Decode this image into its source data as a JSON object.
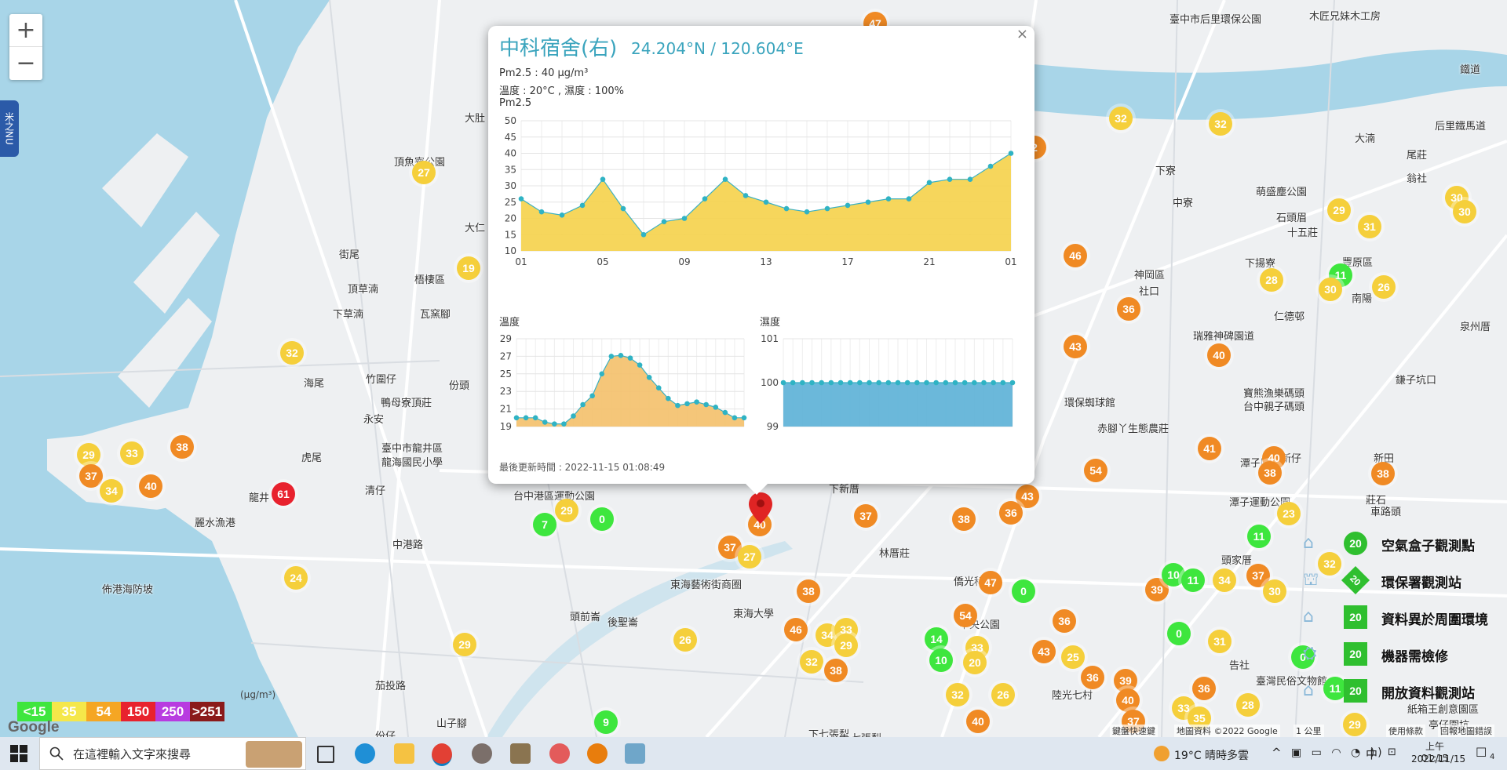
{
  "map": {
    "zoom_in": "+",
    "zoom_out": "−",
    "side_tab": "米之NU",
    "places": [
      {
        "name": "臺中市后里環保公園",
        "x": 1490,
        "y": 14
      },
      {
        "name": "木匠兄妹木工房",
        "x": 1668,
        "y": 10
      },
      {
        "name": "頂魚寮公園",
        "x": 502,
        "y": 196
      },
      {
        "name": "大肚",
        "x": 592,
        "y": 140
      },
      {
        "name": "大仁",
        "x": 592,
        "y": 280
      },
      {
        "name": "街尾",
        "x": 432,
        "y": 314
      },
      {
        "name": "梧棲區",
        "x": 528,
        "y": 346
      },
      {
        "name": "頂草湳",
        "x": 443,
        "y": 358
      },
      {
        "name": "下草湳",
        "x": 424,
        "y": 390
      },
      {
        "name": "瓦窯腳",
        "x": 535,
        "y": 390
      },
      {
        "name": "海尾",
        "x": 387,
        "y": 478
      },
      {
        "name": "竹圍仔",
        "x": 466,
        "y": 473
      },
      {
        "name": "鴨母寮頂莊",
        "x": 485,
        "y": 503
      },
      {
        "name": "永安",
        "x": 463,
        "y": 524
      },
      {
        "name": "虎尾",
        "x": 384,
        "y": 573
      },
      {
        "name": "臺中市龍井區",
        "x": 486,
        "y": 561
      },
      {
        "name": "龍海國民小學",
        "x": 486,
        "y": 579
      },
      {
        "name": "清仔",
        "x": 465,
        "y": 615
      },
      {
        "name": "龍井",
        "x": 317,
        "y": 624
      },
      {
        "name": "麗水漁港",
        "x": 248,
        "y": 656
      },
      {
        "name": "佈港海防坡",
        "x": 130,
        "y": 741
      },
      {
        "name": "台中港區運動公園",
        "x": 654,
        "y": 622
      },
      {
        "name": "東海藝術街商圈",
        "x": 854,
        "y": 735
      },
      {
        "name": "頭前崙",
        "x": 726,
        "y": 776
      },
      {
        "name": "後聖崙",
        "x": 774,
        "y": 783
      },
      {
        "name": "東海大學",
        "x": 934,
        "y": 772
      },
      {
        "name": "林厝莊",
        "x": 1120,
        "y": 695
      },
      {
        "name": "中央公園",
        "x": 1222,
        "y": 786
      },
      {
        "name": "下新厝",
        "x": 1056,
        "y": 613
      },
      {
        "name": "神岡區",
        "x": 1445,
        "y": 340
      },
      {
        "name": "社口",
        "x": 1451,
        "y": 361
      },
      {
        "name": "中寮",
        "x": 1494,
        "y": 248
      },
      {
        "name": "下寮",
        "x": 1472,
        "y": 207
      },
      {
        "name": "豐原區",
        "x": 1710,
        "y": 324
      },
      {
        "name": "南陽",
        "x": 1722,
        "y": 370
      },
      {
        "name": "仁德邨",
        "x": 1623,
        "y": 393
      },
      {
        "name": "泉州厝",
        "x": 1860,
        "y": 406
      },
      {
        "name": "瑞雅神碑園道",
        "x": 1520,
        "y": 418
      },
      {
        "name": "寶熊漁樂碼頭",
        "x": 1584,
        "y": 491
      },
      {
        "name": "台中親子碼頭",
        "x": 1584,
        "y": 508
      },
      {
        "name": "赤腳丫生態農莊",
        "x": 1398,
        "y": 536
      },
      {
        "name": "環保蜘球館",
        "x": 1356,
        "y": 503
      },
      {
        "name": "潭子運動公園",
        "x": 1566,
        "y": 630
      },
      {
        "name": "新仔",
        "x": 1632,
        "y": 574
      },
      {
        "name": "新田",
        "x": 1750,
        "y": 574
      },
      {
        "name": "潭子區",
        "x": 1580,
        "y": 580
      },
      {
        "name": "莊石",
        "x": 1740,
        "y": 627
      },
      {
        "name": "車路頭",
        "x": 1746,
        "y": 642
      },
      {
        "name": "頭家厝",
        "x": 1556,
        "y": 704
      },
      {
        "name": "僑光科技",
        "x": 1215,
        "y": 731
      },
      {
        "name": "石頭眉",
        "x": 1626,
        "y": 267
      },
      {
        "name": "十五莊",
        "x": 1640,
        "y": 286
      },
      {
        "name": "下揚寮",
        "x": 1586,
        "y": 325
      },
      {
        "name": "后里鐵馬道",
        "x": 1828,
        "y": 150
      },
      {
        "name": "大湳",
        "x": 1726,
        "y": 166
      },
      {
        "name": "尾莊",
        "x": 1792,
        "y": 187
      },
      {
        "name": "翁社",
        "x": 1792,
        "y": 217
      },
      {
        "name": "萌盛塵公園",
        "x": 1600,
        "y": 234
      },
      {
        "name": "鎌子坑口",
        "x": 1778,
        "y": 474
      },
      {
        "name": "七張犁",
        "x": 1084,
        "y": 931
      },
      {
        "name": "中港路",
        "x": 500,
        "y": 684
      },
      {
        "name": "茄投路",
        "x": 478,
        "y": 864
      },
      {
        "name": "份仔",
        "x": 478,
        "y": 928
      },
      {
        "name": "山子腳",
        "x": 556,
        "y": 912
      },
      {
        "name": "陸光七村",
        "x": 1340,
        "y": 876
      },
      {
        "name": "亭仔圍坑",
        "x": 1820,
        "y": 914
      },
      {
        "name": "紙箱王創意園區",
        "x": 1793,
        "y": 894
      },
      {
        "name": "告社",
        "x": 1566,
        "y": 838
      },
      {
        "name": "臺灣民俗文物館",
        "x": 1600,
        "y": 858
      },
      {
        "name": "下七張犁",
        "x": 1030,
        "y": 926
      },
      {
        "name": "份頭",
        "x": 572,
        "y": 481
      },
      {
        "name": "鐵道",
        "x": 1860,
        "y": 78
      }
    ],
    "markers": [
      {
        "v": "47",
        "c": "#f08a24",
        "x": 1115,
        "y": 30
      },
      {
        "v": "32",
        "c": "#f5cf3b",
        "x": 1428,
        "y": 151
      },
      {
        "v": "32",
        "c": "#f5cf3b",
        "x": 1555,
        "y": 158
      },
      {
        "v": "27",
        "c": "#f5cf3b",
        "x": 540,
        "y": 220
      },
      {
        "v": "2",
        "c": "#f08a24",
        "x": 1318,
        "y": 188
      },
      {
        "v": "46",
        "c": "#f08a24",
        "x": 1370,
        "y": 326
      },
      {
        "v": "36",
        "c": "#f08a24",
        "x": 1438,
        "y": 394
      },
      {
        "v": "43",
        "c": "#f08a24",
        "x": 1370,
        "y": 442
      },
      {
        "v": "40",
        "c": "#f08a24",
        "x": 1553,
        "y": 453
      },
      {
        "v": "19",
        "c": "#f5cf3b",
        "x": 597,
        "y": 342
      },
      {
        "v": "32",
        "c": "#f5cf3b",
        "x": 372,
        "y": 450
      },
      {
        "v": "29",
        "c": "#f5cf3b",
        "x": 1706,
        "y": 268
      },
      {
        "v": "31",
        "c": "#f5cf3b",
        "x": 1745,
        "y": 289
      },
      {
        "v": "30",
        "c": "#f5cf3b",
        "x": 1856,
        "y": 252
      },
      {
        "v": "30",
        "c": "#f5cf3b",
        "x": 1866,
        "y": 270
      },
      {
        "v": "28",
        "c": "#f5cf3b",
        "x": 1620,
        "y": 357
      },
      {
        "v": "11",
        "c": "#3ee63e",
        "x": 1708,
        "y": 351
      },
      {
        "v": "30",
        "c": "#f5cf3b",
        "x": 1695,
        "y": 369
      },
      {
        "v": "26",
        "c": "#f5cf3b",
        "x": 1763,
        "y": 366
      },
      {
        "v": "29",
        "c": "#f5cf3b",
        "x": 113,
        "y": 580
      },
      {
        "v": "33",
        "c": "#f5cf3b",
        "x": 168,
        "y": 578
      },
      {
        "v": "38",
        "c": "#f08a24",
        "x": 232,
        "y": 570
      },
      {
        "v": "37",
        "c": "#f08a24",
        "x": 116,
        "y": 607
      },
      {
        "v": "40",
        "c": "#f08a24",
        "x": 192,
        "y": 620
      },
      {
        "v": "34",
        "c": "#f5cf3b",
        "x": 142,
        "y": 626
      },
      {
        "v": "61",
        "c": "#e8222e",
        "x": 361,
        "y": 630
      },
      {
        "v": "29",
        "c": "#f5cf3b",
        "x": 722,
        "y": 651
      },
      {
        "v": "7",
        "c": "#3ee63e",
        "x": 694,
        "y": 669
      },
      {
        "v": "0",
        "c": "#3ee63e",
        "x": 767,
        "y": 662
      },
      {
        "v": "37",
        "c": "#f08a24",
        "x": 1103,
        "y": 658
      },
      {
        "v": "38",
        "c": "#f08a24",
        "x": 1228,
        "y": 662
      },
      {
        "v": "43",
        "c": "#f08a24",
        "x": 1309,
        "y": 633
      },
      {
        "v": "36",
        "c": "#f08a24",
        "x": 1288,
        "y": 654
      },
      {
        "v": "54",
        "c": "#f08a24",
        "x": 1396,
        "y": 600
      },
      {
        "v": "41",
        "c": "#f08a24",
        "x": 1541,
        "y": 572
      },
      {
        "v": "40",
        "c": "#f08a24",
        "x": 1623,
        "y": 584
      },
      {
        "v": "38",
        "c": "#f08a24",
        "x": 1618,
        "y": 603
      },
      {
        "v": "38",
        "c": "#f08a24",
        "x": 1762,
        "y": 604
      },
      {
        "v": "23",
        "c": "#f5cf3b",
        "x": 1642,
        "y": 655
      },
      {
        "v": "11",
        "c": "#3ee63e",
        "x": 1604,
        "y": 684
      },
      {
        "v": "40",
        "c": "#f08a24",
        "x": 968,
        "y": 669
      },
      {
        "v": "37",
        "c": "#f08a24",
        "x": 930,
        "y": 698
      },
      {
        "v": "27",
        "c": "#f5cf3b",
        "x": 955,
        "y": 710
      },
      {
        "v": "24",
        "c": "#f5cf3b",
        "x": 377,
        "y": 737
      },
      {
        "v": "38",
        "c": "#f08a24",
        "x": 1030,
        "y": 754
      },
      {
        "v": "47",
        "c": "#f08a24",
        "x": 1262,
        "y": 743
      },
      {
        "v": "0",
        "c": "#3ee63e",
        "x": 1304,
        "y": 754
      },
      {
        "v": "54",
        "c": "#f08a24",
        "x": 1230,
        "y": 785
      },
      {
        "v": "36",
        "c": "#f08a24",
        "x": 1356,
        "y": 792
      },
      {
        "v": "39",
        "c": "#f08a24",
        "x": 1474,
        "y": 752
      },
      {
        "v": "10",
        "c": "#3ee63e",
        "x": 1495,
        "y": 733
      },
      {
        "v": "11",
        "c": "#3ee63e",
        "x": 1520,
        "y": 740
      },
      {
        "v": "34",
        "c": "#f5cf3b",
        "x": 1560,
        "y": 740
      },
      {
        "v": "37",
        "c": "#f08a24",
        "x": 1603,
        "y": 734
      },
      {
        "v": "30",
        "c": "#f5cf3b",
        "x": 1624,
        "y": 754
      },
      {
        "v": "32",
        "c": "#f5cf3b",
        "x": 1694,
        "y": 719
      },
      {
        "v": "26",
        "c": "#f5cf3b",
        "x": 873,
        "y": 816
      },
      {
        "v": "46",
        "c": "#f08a24",
        "x": 1014,
        "y": 803
      },
      {
        "v": "34",
        "c": "#f5cf3b",
        "x": 1054,
        "y": 810
      },
      {
        "v": "33",
        "c": "#f5cf3b",
        "x": 1078,
        "y": 803
      },
      {
        "v": "29",
        "c": "#f5cf3b",
        "x": 1078,
        "y": 823
      },
      {
        "v": "32",
        "c": "#f5cf3b",
        "x": 1034,
        "y": 844
      },
      {
        "v": "38",
        "c": "#f08a24",
        "x": 1065,
        "y": 855
      },
      {
        "v": "14",
        "c": "#3ee63e",
        "x": 1193,
        "y": 815
      },
      {
        "v": "10",
        "c": "#3ee63e",
        "x": 1199,
        "y": 842
      },
      {
        "v": "33",
        "c": "#f5cf3b",
        "x": 1245,
        "y": 826
      },
      {
        "v": "20",
        "c": "#f5cf3b",
        "x": 1242,
        "y": 845
      },
      {
        "v": "43",
        "c": "#f08a24",
        "x": 1330,
        "y": 831
      },
      {
        "v": "25",
        "c": "#f5cf3b",
        "x": 1367,
        "y": 838
      },
      {
        "v": "0",
        "c": "#3ee63e",
        "x": 1502,
        "y": 808
      },
      {
        "v": "31",
        "c": "#f5cf3b",
        "x": 1554,
        "y": 818
      },
      {
        "v": "0",
        "c": "#3ee63e",
        "x": 1660,
        "y": 838
      },
      {
        "v": "29",
        "c": "#f5cf3b",
        "x": 592,
        "y": 822
      },
      {
        "v": "36",
        "c": "#f08a24",
        "x": 1392,
        "y": 864
      },
      {
        "v": "39",
        "c": "#f08a24",
        "x": 1434,
        "y": 868
      },
      {
        "v": "36",
        "c": "#f08a24",
        "x": 1534,
        "y": 878
      },
      {
        "v": "32",
        "c": "#f5cf3b",
        "x": 1220,
        "y": 886
      },
      {
        "v": "26",
        "c": "#f5cf3b",
        "x": 1278,
        "y": 886
      },
      {
        "v": "40",
        "c": "#f08a24",
        "x": 1437,
        "y": 893
      },
      {
        "v": "33",
        "c": "#f5cf3b",
        "x": 1508,
        "y": 903
      },
      {
        "v": "28",
        "c": "#f5cf3b",
        "x": 1590,
        "y": 899
      },
      {
        "v": "40",
        "c": "#f08a24",
        "x": 1246,
        "y": 920
      },
      {
        "v": "37",
        "c": "#f08a24",
        "x": 1444,
        "y": 920
      },
      {
        "v": "35",
        "c": "#f5cf3b",
        "x": 1528,
        "y": 916
      },
      {
        "v": "9",
        "c": "#3ee63e",
        "x": 772,
        "y": 921
      },
      {
        "v": "11",
        "c": "#3ee63e",
        "x": 1701,
        "y": 878
      },
      {
        "v": "29",
        "c": "#f5cf3b",
        "x": 1726,
        "y": 924
      }
    ]
  },
  "popup": {
    "title": "中科宿舍(右)",
    "coord": "24.204°N / 120.604°E",
    "pm25_line": "Pm2.5 : 40 μg/m³",
    "temp_line": "溫度 : 20°C , 濕度 : 100%",
    "pm_chart_label": "Pm2.5",
    "temp_chart_label": "溫度",
    "hum_chart_label": "濕度",
    "update": "最後更新時間 : 2022-11-15 01:08:49",
    "close": "×"
  },
  "chart_data": [
    {
      "type": "area",
      "title": "Pm2.5",
      "ylim": [
        10,
        50
      ],
      "yticks": [
        10,
        15,
        20,
        25,
        30,
        35,
        40,
        45,
        50
      ],
      "xticks": [
        "01",
        "05",
        "09",
        "13",
        "17",
        "21",
        "01"
      ],
      "values": [
        26,
        22,
        21,
        24,
        32,
        23,
        15,
        19,
        20,
        26,
        32,
        27,
        25,
        23,
        22,
        23,
        24,
        25,
        26,
        26,
        31,
        32,
        32,
        36,
        40
      ],
      "color": "#f5d24a"
    },
    {
      "type": "area",
      "title": "溫度",
      "ylim": [
        19,
        29
      ],
      "yticks": [
        19,
        21,
        23,
        25,
        27,
        29
      ],
      "values": [
        20,
        20,
        20,
        19.5,
        19.3,
        19.3,
        20.2,
        21.5,
        22.5,
        25,
        27,
        27.1,
        26.8,
        26,
        24.6,
        23.4,
        22.2,
        21.4,
        21.6,
        21.8,
        21.5,
        21.2,
        20.6,
        20,
        20
      ],
      "color": "#f4c06a"
    },
    {
      "type": "area",
      "title": "濕度",
      "ylim": [
        99,
        101
      ],
      "yticks": [
        99,
        100,
        101
      ],
      "values": [
        100,
        100,
        100,
        100,
        100,
        100,
        100,
        100,
        100,
        100,
        100,
        100,
        100,
        100,
        100,
        100,
        100,
        100,
        100,
        100,
        100,
        100,
        100,
        100,
        100
      ],
      "color": "#5bb0d6"
    }
  ],
  "legend": {
    "bins": [
      {
        "label": "<15",
        "color": "#3ee63e"
      },
      {
        "label": "35",
        "color": "#f5e74a"
      },
      {
        "label": "54",
        "color": "#f5a623"
      },
      {
        "label": "150",
        "color": "#e8222e"
      },
      {
        "label": "250",
        "color": "#b83be0"
      },
      {
        "label": ">251",
        "color": "#8b1a1a"
      }
    ],
    "unit": "(μg/m³)"
  },
  "types": [
    {
      "label": "空氣盒子觀測點",
      "badge": "20"
    },
    {
      "label": "環保署觀測站",
      "badge": "20"
    },
    {
      "label": "資料異於周圍環境",
      "badge": "20"
    },
    {
      "label": "機器需檢修",
      "badge": "20"
    },
    {
      "label": "開放資料觀測站",
      "badge": "20"
    }
  ],
  "attribution": {
    "shortcuts": "鍵盤快速鍵",
    "mapdata": "地圖資料 ©2022 Google",
    "scale": "1 公里",
    "terms": "使用條款",
    "report": "回報地圖錯誤",
    "google": "Google"
  },
  "taskbar": {
    "search_placeholder": "在這裡輸入文字來搜尋",
    "weather": "19°C 晴時多雲",
    "ime": "中",
    "time": "上午 01:15",
    "date": "2022/11/15",
    "notif": "4"
  }
}
